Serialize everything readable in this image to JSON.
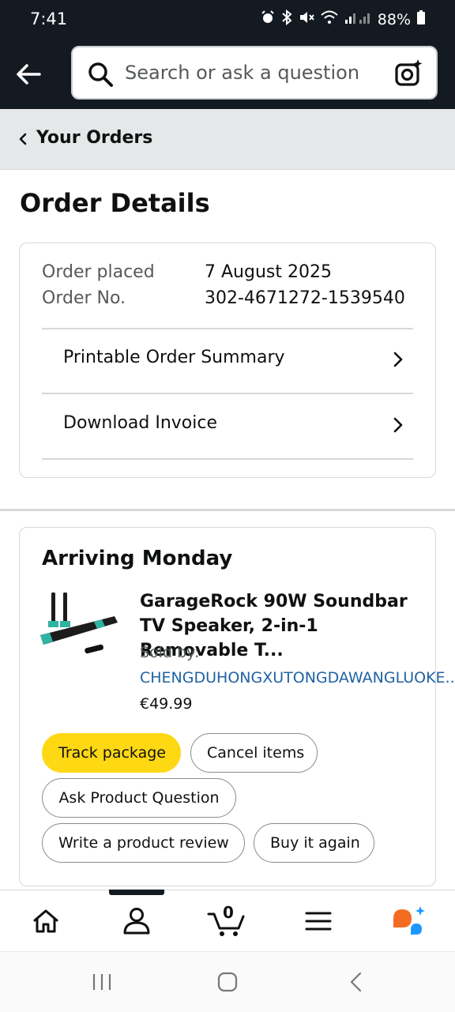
{
  "status_bar": {
    "time": "7:41",
    "battery": "88%"
  },
  "search": {
    "placeholder": "Search or ask a question"
  },
  "breadcrumb": {
    "label": "Your Orders"
  },
  "page_title": "Order Details",
  "order": {
    "placed_label": "Order placed",
    "placed_value": "7 August 2025",
    "number_label": "Order No.",
    "number_value": "302-4671272-1539540",
    "links": [
      "Printable Order Summary",
      "Download Invoice"
    ]
  },
  "shipment": {
    "status": "Arriving Monday",
    "product_title": "GarageRock 90W Soundbar TV Speaker, 2-in-1 Removable T...",
    "sold_by_label": "Sold by:",
    "seller": "CHENGDUHONGXUTONGDAWANGLUOKE...",
    "price": "€49.99",
    "buttons": {
      "track": "Track package",
      "cancel": "Cancel items",
      "question": "Ask Product Question",
      "review": "Write a product review",
      "buy_again": "Buy it again"
    }
  },
  "bottom_nav": {
    "items": [
      "home-icon",
      "account-icon",
      "cart-icon",
      "menu-icon",
      "rufus-assistant-icon"
    ],
    "cart_count": "0"
  },
  "colors": {
    "header_bg": "#131a22",
    "track_button": "#ffd814",
    "link": "#2162a1"
  }
}
